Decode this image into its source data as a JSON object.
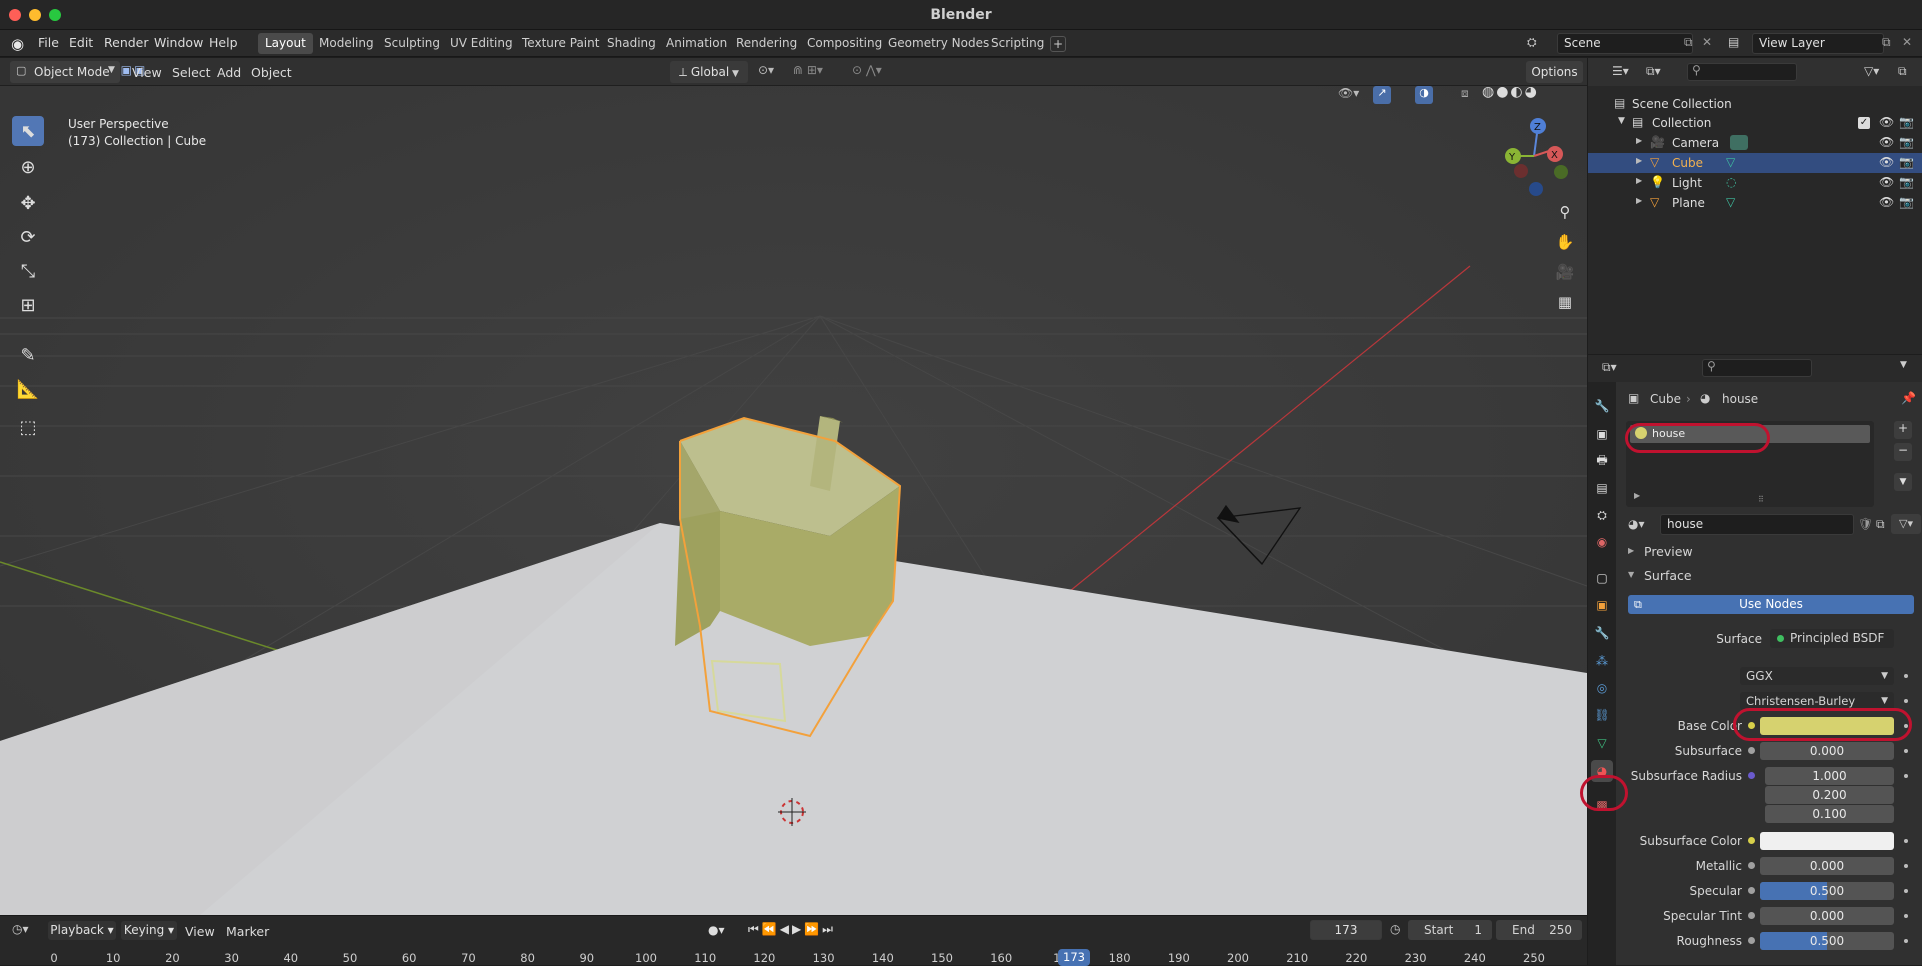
{
  "window": {
    "title": "Blender"
  },
  "menu": [
    "File",
    "Edit",
    "Render",
    "Window",
    "Help"
  ],
  "workspaces": [
    "Layout",
    "Modeling",
    "Sculpting",
    "UV Editing",
    "Texture Paint",
    "Shading",
    "Animation",
    "Rendering",
    "Compositing",
    "Geometry Nodes",
    "Scripting"
  ],
  "active_workspace": "Layout",
  "scene": {
    "name": "Scene",
    "view_layer": "View Layer"
  },
  "header3d": {
    "mode": "Object Mode",
    "items": [
      "View",
      "Select",
      "Add",
      "Object"
    ],
    "orientation": "Global",
    "options": "Options"
  },
  "viewport": {
    "view_name": "User Perspective",
    "context": "(173) Collection | Cube"
  },
  "outliner": {
    "root": "Scene Collection",
    "collection": "Collection",
    "objects": [
      {
        "name": "Camera",
        "icon": "camera-icon",
        "selected": false
      },
      {
        "name": "Cube",
        "icon": "mesh-icon",
        "selected": true
      },
      {
        "name": "Light",
        "icon": "light-icon",
        "selected": false
      },
      {
        "name": "Plane",
        "icon": "mesh-icon",
        "selected": false
      }
    ]
  },
  "properties": {
    "breadcrumb": {
      "object": "Cube",
      "material": "house"
    },
    "slot": "house",
    "material_name": "house",
    "panels": {
      "preview": "Preview",
      "surface": "Surface"
    },
    "use_nodes": "Use Nodes",
    "surface_label": "Surface",
    "surface_value": "Principled BSDF",
    "distribution": "GGX",
    "subsurface_method": "Christensen-Burley",
    "fields": {
      "base_color": {
        "label": "Base Color",
        "color": "#d6d26f"
      },
      "subsurface": {
        "label": "Subsurface",
        "value": "0.000"
      },
      "subsurface_radius": {
        "label": "Subsurface Radius",
        "values": [
          "1.000",
          "0.200",
          "0.100"
        ]
      },
      "subsurface_color": {
        "label": "Subsurface Color",
        "color": "#f0f0f0"
      },
      "metallic": {
        "label": "Metallic",
        "value": "0.000"
      },
      "specular": {
        "label": "Specular",
        "value": "0.500",
        "fraction": 0.5
      },
      "specular_tint": {
        "label": "Specular Tint",
        "value": "0.000"
      },
      "roughness": {
        "label": "Roughness",
        "value": "0.500",
        "fraction": 0.5
      }
    }
  },
  "timeline": {
    "menus": [
      "Playback",
      "Keying",
      "View",
      "Marker"
    ],
    "current_frame": "173",
    "start_label": "Start",
    "start": "1",
    "end_label": "End",
    "end": "250",
    "ticks": [
      "0",
      "10",
      "20",
      "30",
      "40",
      "50",
      "60",
      "70",
      "80",
      "90",
      "100",
      "110",
      "120",
      "130",
      "140",
      "150",
      "160",
      "17",
      "180",
      "190",
      "200",
      "210",
      "220",
      "230",
      "240",
      "250"
    ]
  },
  "colors": {
    "accent": "#4772b3",
    "selection": "#f3a13b",
    "highlight_circle": "#c0122f"
  }
}
